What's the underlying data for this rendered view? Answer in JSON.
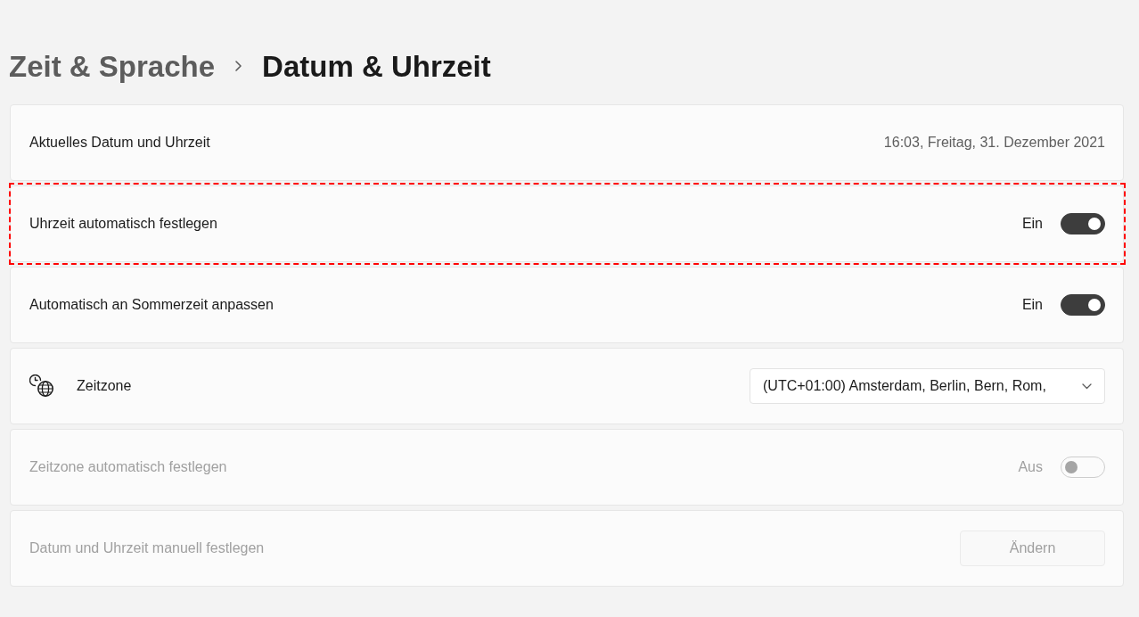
{
  "breadcrumb": [
    {
      "label": "Zeit & Sprache",
      "current": false
    },
    {
      "label": "Datum & Uhrzeit",
      "current": true
    }
  ],
  "settings": [
    {
      "kind": "info",
      "label": "Aktuelles Datum und Uhrzeit",
      "value": "16:03, Freitag, 31. Dezember 2021",
      "disabled": false,
      "highlighted": false
    },
    {
      "kind": "toggle",
      "label": "Uhrzeit automatisch festlegen",
      "state_label": "Ein",
      "on": true,
      "disabled": false,
      "highlighted": true
    },
    {
      "kind": "toggle",
      "label": "Automatisch an Sommerzeit anpassen",
      "state_label": "Ein",
      "on": true,
      "disabled": false,
      "highlighted": false
    },
    {
      "kind": "dropdown",
      "label": "Zeitzone",
      "value": "(UTC+01:00) Amsterdam, Berlin, Bern, Rom,",
      "disabled": false,
      "highlighted": false
    },
    {
      "kind": "toggle",
      "label": "Zeitzone automatisch festlegen",
      "state_label": "Aus",
      "on": false,
      "disabled": true,
      "highlighted": false
    },
    {
      "kind": "button",
      "label": "Datum und Uhrzeit manuell festlegen",
      "button": "Ändern",
      "disabled": true,
      "highlighted": false
    }
  ]
}
